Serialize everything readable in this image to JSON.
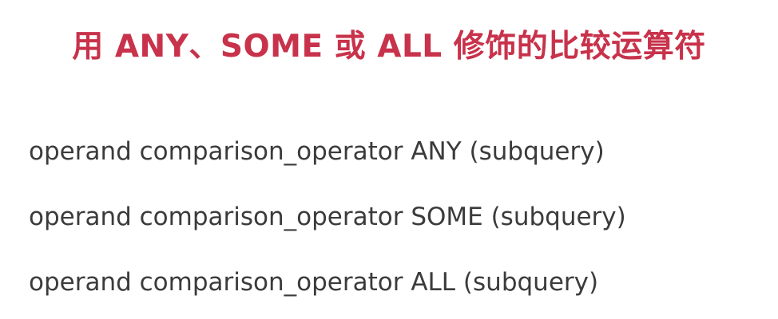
{
  "slide": {
    "title": "用 ANY、SOME 或 ALL 修饰的比较运算符",
    "title_color": "#c8324b",
    "text_color": "#3b3b3b",
    "lines": [
      "operand comparison_operator ANY (subquery)",
      "operand comparison_operator SOME (subquery)",
      "operand comparison_operator ALL (subquery)"
    ]
  }
}
